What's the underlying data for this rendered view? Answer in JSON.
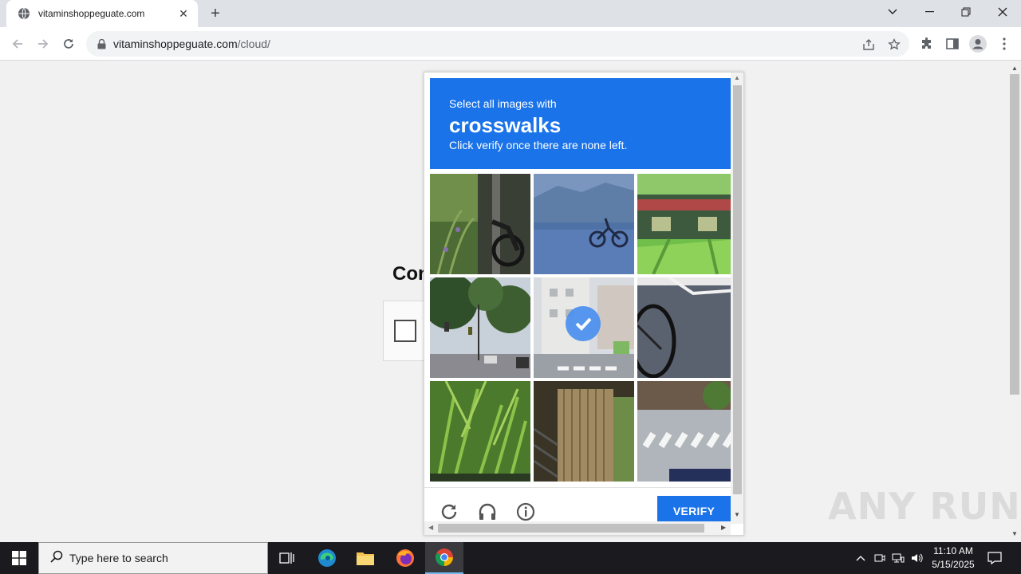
{
  "browser": {
    "tab_title": "vitaminshoppeguate.com",
    "url_host": "vitaminshoppeguate.com",
    "url_path": "/cloud/",
    "icons": [
      "globe-icon",
      "close-icon",
      "plus-icon",
      "back-icon",
      "forward-icon",
      "reload-icon",
      "lock-icon",
      "share-icon",
      "star-icon",
      "extensions-icon",
      "side-panel-icon",
      "profile-icon",
      "kebab-menu-icon",
      "chevron-down-icon",
      "minimize-icon",
      "restore-icon",
      "window-close-icon"
    ]
  },
  "page": {
    "partial_heading": "Con"
  },
  "captcha": {
    "instruction": "Select all images with",
    "target": "crosswalks",
    "hint": "Click verify once there are none left.",
    "verify_label": "VERIFY",
    "tiles": [
      {
        "name": "tile-1",
        "selected": false
      },
      {
        "name": "tile-2",
        "selected": false
      },
      {
        "name": "tile-3",
        "selected": false
      },
      {
        "name": "tile-4",
        "selected": false
      },
      {
        "name": "tile-5",
        "selected": true
      },
      {
        "name": "tile-6",
        "selected": false
      },
      {
        "name": "tile-7",
        "selected": false
      },
      {
        "name": "tile-8",
        "selected": false
      },
      {
        "name": "tile-9",
        "selected": false
      }
    ],
    "accent": "#1a73e8"
  },
  "watermark": "ANY RUN",
  "taskbar": {
    "search_placeholder": "Type here to search",
    "time": "11:10 AM",
    "date": "5/15/2025"
  }
}
